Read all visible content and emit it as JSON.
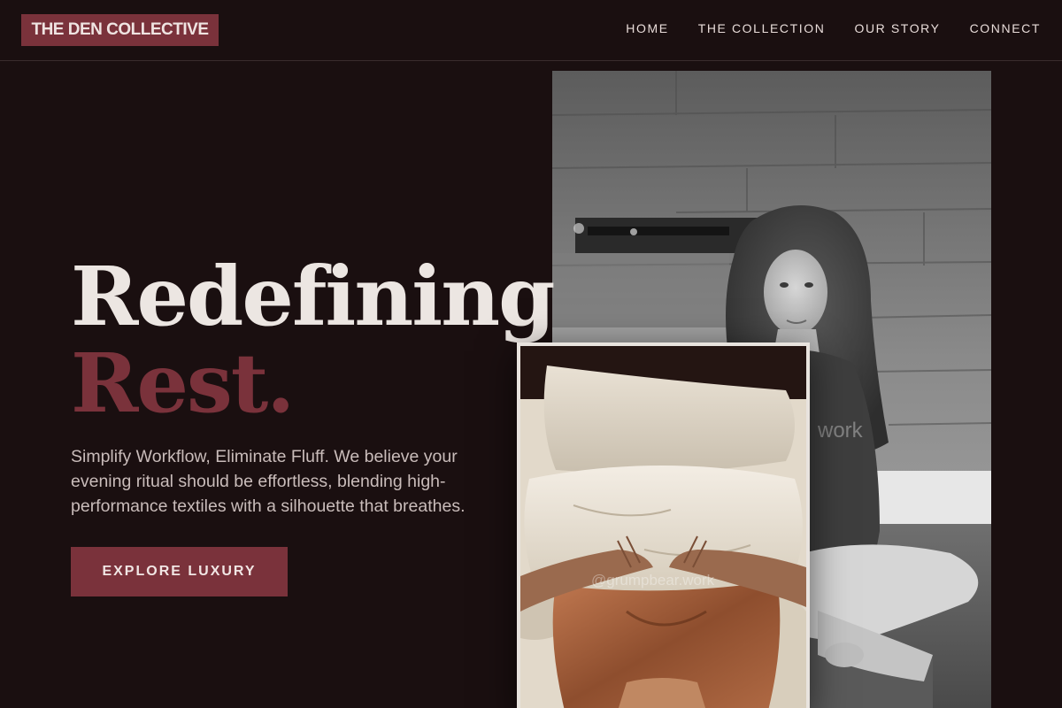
{
  "header": {
    "brand": "THE DEN COLLECTIVE",
    "nav": [
      {
        "label": "HOME"
      },
      {
        "label": "THE COLLECTION"
      },
      {
        "label": "OUR STORY"
      },
      {
        "label": "CONNECT"
      }
    ]
  },
  "hero": {
    "headline_line1": "Redefining",
    "headline_line2": "Rest.",
    "description": "Simplify Workflow, Eliminate Fluff. We believe your evening ritual should be effortless, blending high-performance textiles with a silhouette that breathes.",
    "cta_label": "EXPLORE LUXURY"
  },
  "images": {
    "main_watermark": "work",
    "overlay_watermark": "@grumpbear.work"
  },
  "colors": {
    "background": "#1a0f10",
    "accent": "#7a323b",
    "text_light": "#ece6e2",
    "text_muted": "#c9bcba"
  }
}
